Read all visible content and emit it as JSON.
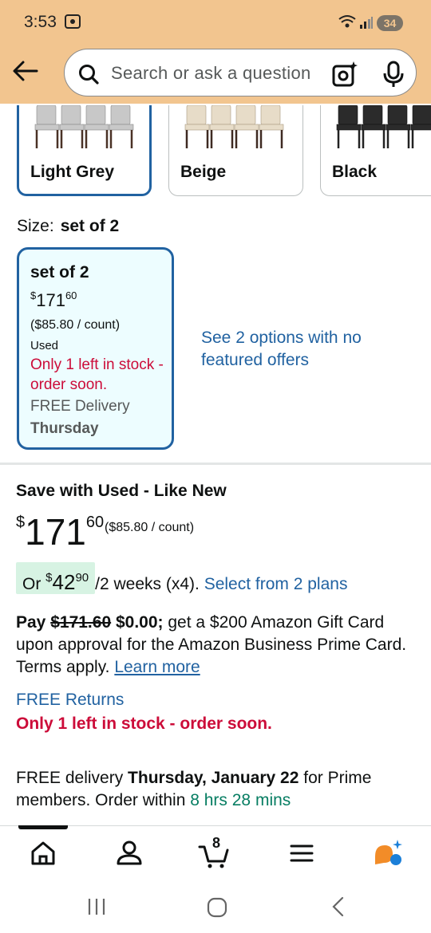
{
  "status_bar": {
    "time": "3:53",
    "battery": "34"
  },
  "header": {
    "search_placeholder": "Search or ask a question"
  },
  "colors": {
    "options": [
      {
        "label": "Light Grey",
        "selected": true
      },
      {
        "label": "Beige",
        "selected": false
      },
      {
        "label": "Black",
        "selected": false
      }
    ]
  },
  "size": {
    "label": "Size:",
    "selected_value": "set of 2",
    "card": {
      "title": "set of 2",
      "price_symbol": "$",
      "price_whole": "171",
      "price_fraction": "60",
      "unit_price": "($85.80 / count)",
      "condition": "Used",
      "stock": "Only 1 left in stock - order soon.",
      "delivery": "FREE Delivery",
      "delivery_day": "Thursday"
    },
    "options_link": "See 2 options with no featured offers"
  },
  "buybox": {
    "title": "Save with Used - Like New",
    "price_symbol": "$",
    "price_whole": "171",
    "price_fraction": "60",
    "unit_price": "($85.80 / count)",
    "installment_or": "Or ",
    "installment_symbol": "$",
    "installment_whole": "42",
    "installment_fraction": "90",
    "installment_terms": "/2 weeks (x4).",
    "installment_link": "Select from 2 plans",
    "promo_pay": "Pay",
    "promo_strike": "$171.60",
    "promo_new": "$0.00;",
    "promo_text": "get a $200 Amazon Gift Card upon approval for the Amazon Business Prime Card. Terms apply.",
    "promo_link": "Learn more",
    "free_returns": "FREE Returns",
    "stock_alert": "Only 1 left in stock - order soon.",
    "delivery_prefix": "FREE delivery",
    "delivery_date": "Thursday, January 22",
    "delivery_mid": "for Prime members. Order within",
    "delivery_countdown": "8 hrs 28 mins"
  },
  "bottom_nav": {
    "cart_count": "8",
    "items": [
      "home-icon",
      "account-icon",
      "cart-icon",
      "menu-icon",
      "rufus-icon"
    ]
  },
  "theme": {
    "header_bg": "#f2c58f",
    "link": "#2162a1",
    "alert": "#cc0c39",
    "success": "#067d62"
  }
}
